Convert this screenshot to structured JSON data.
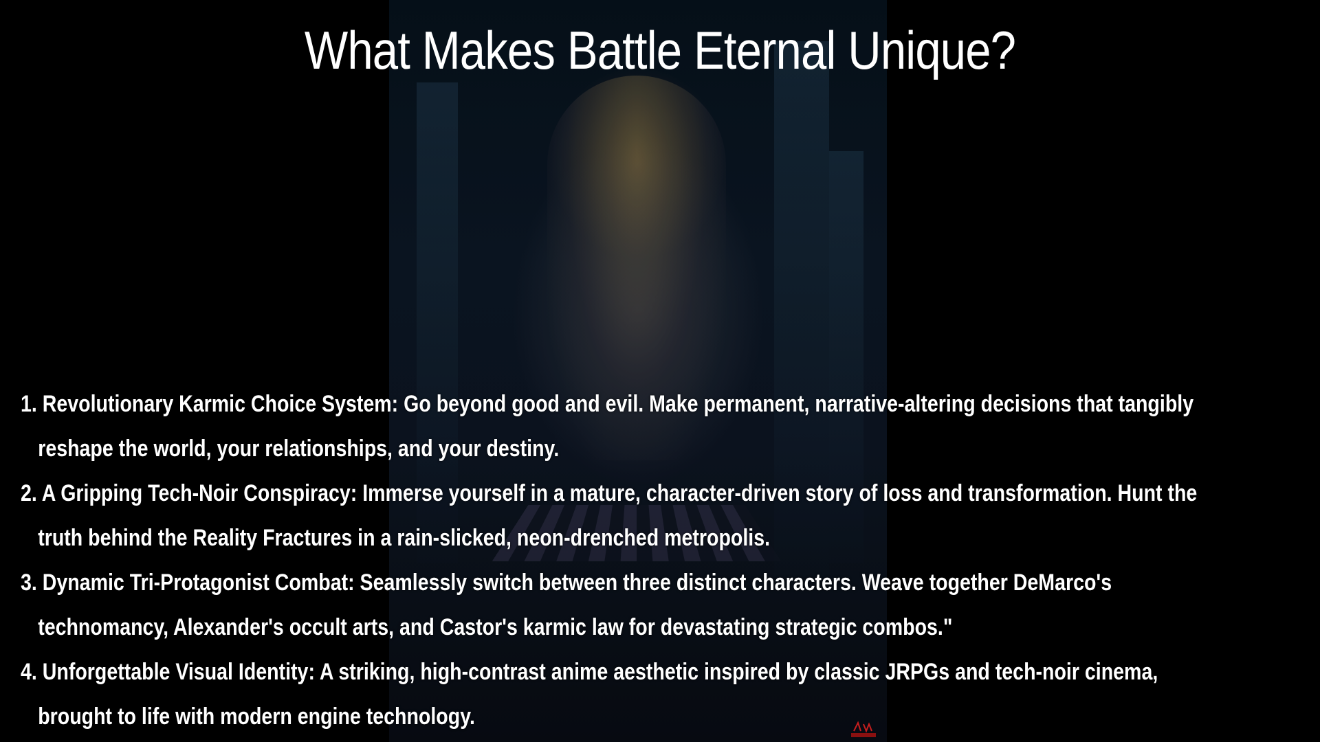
{
  "slide": {
    "title": "What Makes Battle Eternal Unique?",
    "background_color": "#000000",
    "text_color": "#ffffff",
    "features": [
      {
        "number": "1.",
        "line1": "Revolutionary Karmic Choice System: Go beyond good and evil. Make permanent, narrative-altering   decisions that tangibly",
        "line2": "reshape the world, your relationships, and your destiny."
      },
      {
        "number": "2.",
        "line1": "A Gripping Tech-Noir Conspiracy: Immerse yourself in a mature, character-driven story of loss and transformation. Hunt the",
        "line2": "truth behind the Reality Fractures in a rain-slicked, neon-drenched metropolis."
      },
      {
        "number": "3.",
        "line1": "Dynamic Tri-Protagonist Combat: Seamlessly switch between three distinct characters. Weave together DeMarco's",
        "line2": "technomancy, Alexander's occult arts, and Castor's karmic law for devastating strategic combos.\""
      },
      {
        "number": "4.",
        "line1": "Unforgettable Visual Identity: A striking, high-contrast anime aesthetic inspired by classic JRPGs and tech-noir cinema,",
        "line2": "brought to life with modern engine technology."
      }
    ]
  }
}
